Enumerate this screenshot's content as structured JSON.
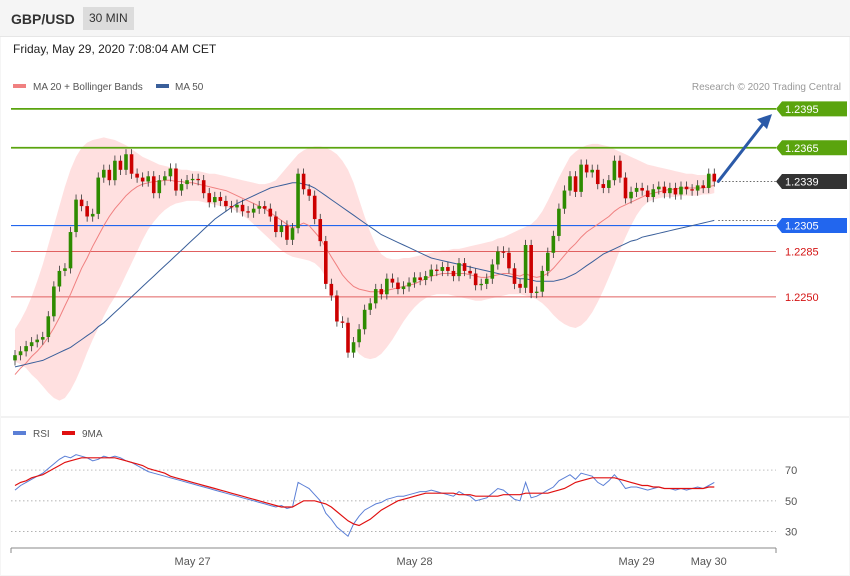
{
  "header": {
    "symbol": "GBP/USD",
    "interval": "30 MIN"
  },
  "timestamp": "Friday, May 29, 2020 7:08:04 AM CET",
  "legend_main": [
    {
      "label": "MA 20 + Bollinger Bands",
      "color": "#f08080"
    },
    {
      "label": "MA 50",
      "color": "#3a5f9a"
    }
  ],
  "copyright": "Research © 2020 Trading Central",
  "legend_rsi": [
    {
      "label": "RSI",
      "color": "#5b7fd6"
    },
    {
      "label": "9MA",
      "color": "#e01010"
    }
  ],
  "colors": {
    "up": "#2e8b00",
    "down": "#cc0000",
    "green_level": "#5aa40e",
    "blue_level": "#2266ee",
    "red_level": "#e06060",
    "arrow": "#2b5aa8",
    "bands": "#ffd6d6"
  },
  "chart_data": [
    {
      "type": "candlestick",
      "price_range": [
        1.2155,
        1.2425
      ],
      "x_labels": [
        "May 27",
        "May 28",
        "May 29",
        "May 30"
      ],
      "levels": [
        {
          "value": 1.2395,
          "label": "1.2395",
          "kind": "green"
        },
        {
          "value": 1.2365,
          "label": "1.2365",
          "kind": "green"
        },
        {
          "value": 1.2305,
          "label": "1.2305",
          "kind": "blue"
        },
        {
          "value": 1.2285,
          "label": "1.2285",
          "kind": "red"
        },
        {
          "value": 1.225,
          "label": "1.2250",
          "kind": "red"
        }
      ],
      "current": {
        "value": 1.2339,
        "label": "1.2339"
      },
      "projection": {
        "from": 1.2339,
        "to": 1.2391
      },
      "close": [
        1.2205,
        1.2208,
        1.2212,
        1.2215,
        1.2217,
        1.2219,
        1.2235,
        1.2258,
        1.227,
        1.2272,
        1.23,
        1.2325,
        1.232,
        1.2312,
        1.2314,
        1.2342,
        1.2348,
        1.234,
        1.2355,
        1.2348,
        1.236,
        1.2345,
        1.2342,
        1.2339,
        1.2343,
        1.233,
        1.234,
        1.2343,
        1.2349,
        1.2332,
        1.2337,
        1.234,
        1.2341,
        1.234,
        1.233,
        1.2323,
        1.2327,
        1.2324,
        1.232,
        1.2319,
        1.2321,
        1.2316,
        1.2315,
        1.2318,
        1.232,
        1.2318,
        1.2312,
        1.23,
        1.2305,
        1.2294,
        1.2303,
        1.2345,
        1.2333,
        1.2328,
        1.231,
        1.2293,
        1.226,
        1.2251,
        1.2231,
        1.223,
        1.2207,
        1.2215,
        1.2225,
        1.224,
        1.2245,
        1.2256,
        1.2252,
        1.2264,
        1.2261,
        1.2256,
        1.2258,
        1.2261,
        1.2265,
        1.2263,
        1.2266,
        1.2271,
        1.227,
        1.2273,
        1.227,
        1.2266,
        1.2276,
        1.227,
        1.2268,
        1.2259,
        1.226,
        1.2264,
        1.2275,
        1.2285,
        1.2284,
        1.2272,
        1.226,
        1.2257,
        1.229,
        1.2253,
        1.2254,
        1.227,
        1.2284,
        1.2297,
        1.2318,
        1.2332,
        1.2343,
        1.2331,
        1.2352,
        1.2346,
        1.2348,
        1.2337,
        1.2334,
        1.234,
        1.2355,
        1.2342,
        1.2326,
        1.2331,
        1.2334,
        1.2332,
        1.2327,
        1.2333,
        1.2335,
        1.233,
        1.2334,
        1.2329,
        1.2335,
        1.2333,
        1.2332,
        1.2336,
        1.2334,
        1.2345,
        1.2339
      ],
      "ma20": [
        1.219,
        1.2195,
        1.2199,
        1.2204,
        1.2208,
        1.2213,
        1.2219,
        1.2226,
        1.2234,
        1.2243,
        1.2252,
        1.2262,
        1.2272,
        1.228,
        1.2289,
        1.2297,
        1.2305,
        1.2312,
        1.2318,
        1.2323,
        1.2328,
        1.2332,
        1.2335,
        1.2337,
        1.2338,
        1.2339,
        1.2339,
        1.234,
        1.234,
        1.2339,
        1.2339,
        1.2338,
        1.2338,
        1.2337,
        1.2336,
        1.2335,
        1.2334,
        1.2333,
        1.2332,
        1.233,
        1.2328,
        1.2326,
        1.2324,
        1.2322,
        1.232,
        1.2318,
        1.2315,
        1.2312,
        1.2309,
        1.2306,
        1.2303,
        1.2305,
        1.2307,
        1.2305,
        1.23,
        1.2295,
        1.2288,
        1.2281,
        1.2274,
        1.2267,
        1.2262,
        1.2258,
        1.2256,
        1.2255,
        1.2254,
        1.2254,
        1.2254,
        1.2255,
        1.2256,
        1.2257,
        1.2258,
        1.2259,
        1.226,
        1.2262,
        1.2264,
        1.2266,
        1.2267,
        1.2268,
        1.2268,
        1.2268,
        1.2268,
        1.2268,
        1.2267,
        1.2266,
        1.2265,
        1.2265,
        1.2266,
        1.2267,
        1.2268,
        1.2268,
        1.2267,
        1.2266,
        1.2268,
        1.2266,
        1.2265,
        1.2266,
        1.2268,
        1.2272,
        1.2277,
        1.2282,
        1.2287,
        1.2291,
        1.2296,
        1.23,
        1.2303,
        1.2306,
        1.2309,
        1.2312,
        1.2316,
        1.2319,
        1.2321,
        1.2323,
        1.2325,
        1.2327,
        1.2329,
        1.233,
        1.2331,
        1.2332,
        1.2333,
        1.2333,
        1.2334,
        1.2334,
        1.2334,
        1.2334,
        1.2334,
        1.2335,
        1.2336
      ],
      "bb_upper": [
        1.2225,
        1.2232,
        1.224,
        1.225,
        1.2262,
        1.2275,
        1.229,
        1.2305,
        1.232,
        1.2335,
        1.2348,
        1.2358,
        1.2365,
        1.2369,
        1.2371,
        1.2372,
        1.2373,
        1.2372,
        1.2371,
        1.2369,
        1.2367,
        1.2364,
        1.2361,
        1.2358,
        1.2356,
        1.2354,
        1.2352,
        1.2351,
        1.235,
        1.2349,
        1.2348,
        1.2348,
        1.2347,
        1.2347,
        1.2346,
        1.2345,
        1.2345,
        1.2344,
        1.2343,
        1.2342,
        1.2341,
        1.234,
        1.2339,
        1.2338,
        1.2337,
        1.2337,
        1.2338,
        1.234,
        1.2345,
        1.235,
        1.2355,
        1.236,
        1.2363,
        1.2365,
        1.2366,
        1.2366,
        1.2365,
        1.2363,
        1.236,
        1.2355,
        1.2348,
        1.2338,
        1.2325,
        1.2312,
        1.23,
        1.229,
        1.2283,
        1.228,
        1.2279,
        1.2279,
        1.228,
        1.228,
        1.2281,
        1.2282,
        1.2283,
        1.2284,
        1.2285,
        1.2286,
        1.2286,
        1.2287,
        1.2287,
        1.2288,
        1.2289,
        1.229,
        1.2291,
        1.2292,
        1.2293,
        1.2295,
        1.2296,
        1.2298,
        1.23,
        1.2302,
        1.2304,
        1.2306,
        1.231,
        1.2316,
        1.2324,
        1.2333,
        1.2342,
        1.235,
        1.2358,
        1.2362,
        1.2365,
        1.2367,
        1.2368,
        1.2368,
        1.2367,
        1.2366,
        1.2364,
        1.2362,
        1.236,
        1.2358,
        1.2356,
        1.2354,
        1.2352,
        1.2351,
        1.235,
        1.2349,
        1.2348,
        1.2347,
        1.2346,
        1.2345,
        1.2345,
        1.2344,
        1.2344,
        1.2344,
        1.2344
      ],
      "bb_lower": [
        1.22,
        1.2198,
        1.2195,
        1.219,
        1.2186,
        1.2181,
        1.2176,
        1.2172,
        1.217,
        1.2172,
        1.2178,
        1.2186,
        1.2196,
        1.2207,
        1.2217,
        1.2226,
        1.2235,
        1.2243,
        1.225,
        1.2258,
        1.2267,
        1.2276,
        1.2285,
        1.2294,
        1.2302,
        1.2308,
        1.2313,
        1.2317,
        1.232,
        1.2322,
        1.2323,
        1.2324,
        1.2324,
        1.2324,
        1.2323,
        1.2322,
        1.2321,
        1.232,
        1.2319,
        1.2318,
        1.2316,
        1.2313,
        1.231,
        1.2306,
        1.2302,
        1.2298,
        1.2294,
        1.229,
        1.2286,
        1.2283,
        1.2281,
        1.228,
        1.2279,
        1.2278,
        1.2276,
        1.2272,
        1.2265,
        1.2256,
        1.2245,
        1.2233,
        1.2222,
        1.2212,
        1.2206,
        1.2203,
        1.2202,
        1.2203,
        1.2206,
        1.2211,
        1.2217,
        1.2224,
        1.2231,
        1.2237,
        1.2242,
        1.2246,
        1.2249,
        1.2251,
        1.2252,
        1.2252,
        1.2252,
        1.2251,
        1.225,
        1.2249,
        1.2248,
        1.2247,
        1.2247,
        1.2248,
        1.2249,
        1.225,
        1.2251,
        1.2252,
        1.2252,
        1.2252,
        1.2251,
        1.225,
        1.2248,
        1.2245,
        1.2241,
        1.2236,
        1.2232,
        1.2229,
        1.2227,
        1.2226,
        1.2228,
        1.2232,
        1.2238,
        1.2246,
        1.2255,
        1.2265,
        1.2275,
        1.2286,
        1.2296,
        1.2305,
        1.2313,
        1.2319,
        1.2323,
        1.2325,
        1.2326,
        1.2327,
        1.2327,
        1.2327,
        1.2328,
        1.2328,
        1.2328,
        1.2328,
        1.2329,
        1.2329,
        1.233
      ],
      "ma50": [
        1.2196,
        1.2197,
        1.2198,
        1.2199,
        1.22,
        1.2201,
        1.2203,
        1.2205,
        1.2207,
        1.2209,
        1.2211,
        1.2214,
        1.2217,
        1.222,
        1.2223,
        1.2227,
        1.223,
        1.2234,
        1.2238,
        1.2242,
        1.2246,
        1.225,
        1.2254,
        1.2258,
        1.2262,
        1.2266,
        1.227,
        1.2274,
        1.2278,
        1.2282,
        1.2286,
        1.229,
        1.2294,
        1.2298,
        1.2302,
        1.2306,
        1.231,
        1.2313,
        1.2316,
        1.2319,
        1.2322,
        1.2324,
        1.2326,
        1.2328,
        1.233,
        1.2332,
        1.2334,
        1.2335,
        1.2336,
        1.2337,
        1.2338,
        1.2338,
        1.2337,
        1.2336,
        1.2334,
        1.2331,
        1.2328,
        1.2325,
        1.2322,
        1.2319,
        1.2316,
        1.2313,
        1.231,
        1.2307,
        1.2304,
        1.2301,
        1.2298,
        1.2296,
        1.2294,
        1.2292,
        1.229,
        1.2288,
        1.2286,
        1.2284,
        1.2282,
        1.228,
        1.2279,
        1.2278,
        1.2277,
        1.2276,
        1.2275,
        1.2274,
        1.2273,
        1.2272,
        1.2271,
        1.227,
        1.2269,
        1.2268,
        1.2267,
        1.2266,
        1.2265,
        1.2264,
        1.2264,
        1.2263,
        1.2262,
        1.2262,
        1.2262,
        1.2262,
        1.2263,
        1.2264,
        1.2266,
        1.2268,
        1.2271,
        1.2274,
        1.2277,
        1.228,
        1.2283,
        1.2285,
        1.2287,
        1.2289,
        1.2291,
        1.2293,
        1.2294,
        1.2296,
        1.2297,
        1.2298,
        1.2299,
        1.23,
        1.2301,
        1.2302,
        1.2303,
        1.2304,
        1.2305,
        1.2306,
        1.2307,
        1.2308,
        1.2309
      ]
    },
    {
      "type": "line",
      "y_range": [
        20,
        85
      ],
      "yticks": [
        {
          "value": 70,
          "label": "70"
        },
        {
          "value": 50,
          "label": "50"
        },
        {
          "value": 30,
          "label": "30"
        }
      ],
      "series": [
        {
          "name": "RSI",
          "values": [
            57,
            60,
            62,
            64,
            66,
            68,
            71,
            74,
            77,
            79,
            78,
            80,
            79,
            78,
            76,
            77,
            79,
            78,
            79,
            78,
            76,
            75,
            73,
            71,
            69,
            68,
            67,
            66,
            65,
            64,
            63,
            62,
            61,
            60,
            59,
            58,
            57,
            56,
            55,
            54,
            53,
            52,
            51,
            50,
            49,
            48,
            47,
            46,
            47,
            45,
            46,
            62,
            60,
            58,
            54,
            50,
            42,
            38,
            33,
            30,
            27,
            35,
            40,
            44,
            46,
            48,
            49,
            51,
            52,
            53,
            53,
            54,
            55,
            56,
            56,
            57,
            56,
            55,
            54,
            53,
            56,
            54,
            53,
            50,
            51,
            52,
            55,
            58,
            57,
            54,
            51,
            50,
            62,
            52,
            53,
            55,
            57,
            59,
            63,
            65,
            67,
            64,
            68,
            67,
            66,
            62,
            60,
            63,
            67,
            63,
            58,
            59,
            59,
            58,
            57,
            58,
            59,
            58,
            58,
            57,
            58,
            57,
            58,
            59,
            58,
            60,
            62
          ]
        },
        {
          "name": "9MA",
          "values": [
            60,
            62,
            63,
            65,
            66,
            67,
            69,
            71,
            73,
            75,
            76,
            77,
            78,
            78,
            78,
            78,
            78,
            78,
            78,
            77,
            76,
            75,
            74,
            73,
            71,
            70,
            69,
            68,
            66,
            65,
            64,
            63,
            62,
            61,
            60,
            59,
            58,
            57,
            56,
            55,
            54,
            53,
            52,
            51,
            50,
            49,
            48,
            47,
            46,
            46,
            46,
            48,
            50,
            50,
            50,
            49,
            48,
            46,
            43,
            40,
            37,
            35,
            34,
            36,
            38,
            41,
            44,
            46,
            48,
            50,
            51,
            52,
            53,
            54,
            55,
            55,
            55,
            55,
            55,
            55,
            54,
            54,
            54,
            53,
            53,
            53,
            53,
            53,
            54,
            54,
            54,
            54,
            55,
            55,
            55,
            55,
            55,
            56,
            57,
            58,
            60,
            62,
            63,
            64,
            65,
            65,
            65,
            65,
            65,
            64,
            63,
            62,
            61,
            60,
            60,
            59,
            59,
            58,
            58,
            58,
            58,
            58,
            58,
            58,
            58,
            59,
            59
          ]
        }
      ]
    }
  ]
}
